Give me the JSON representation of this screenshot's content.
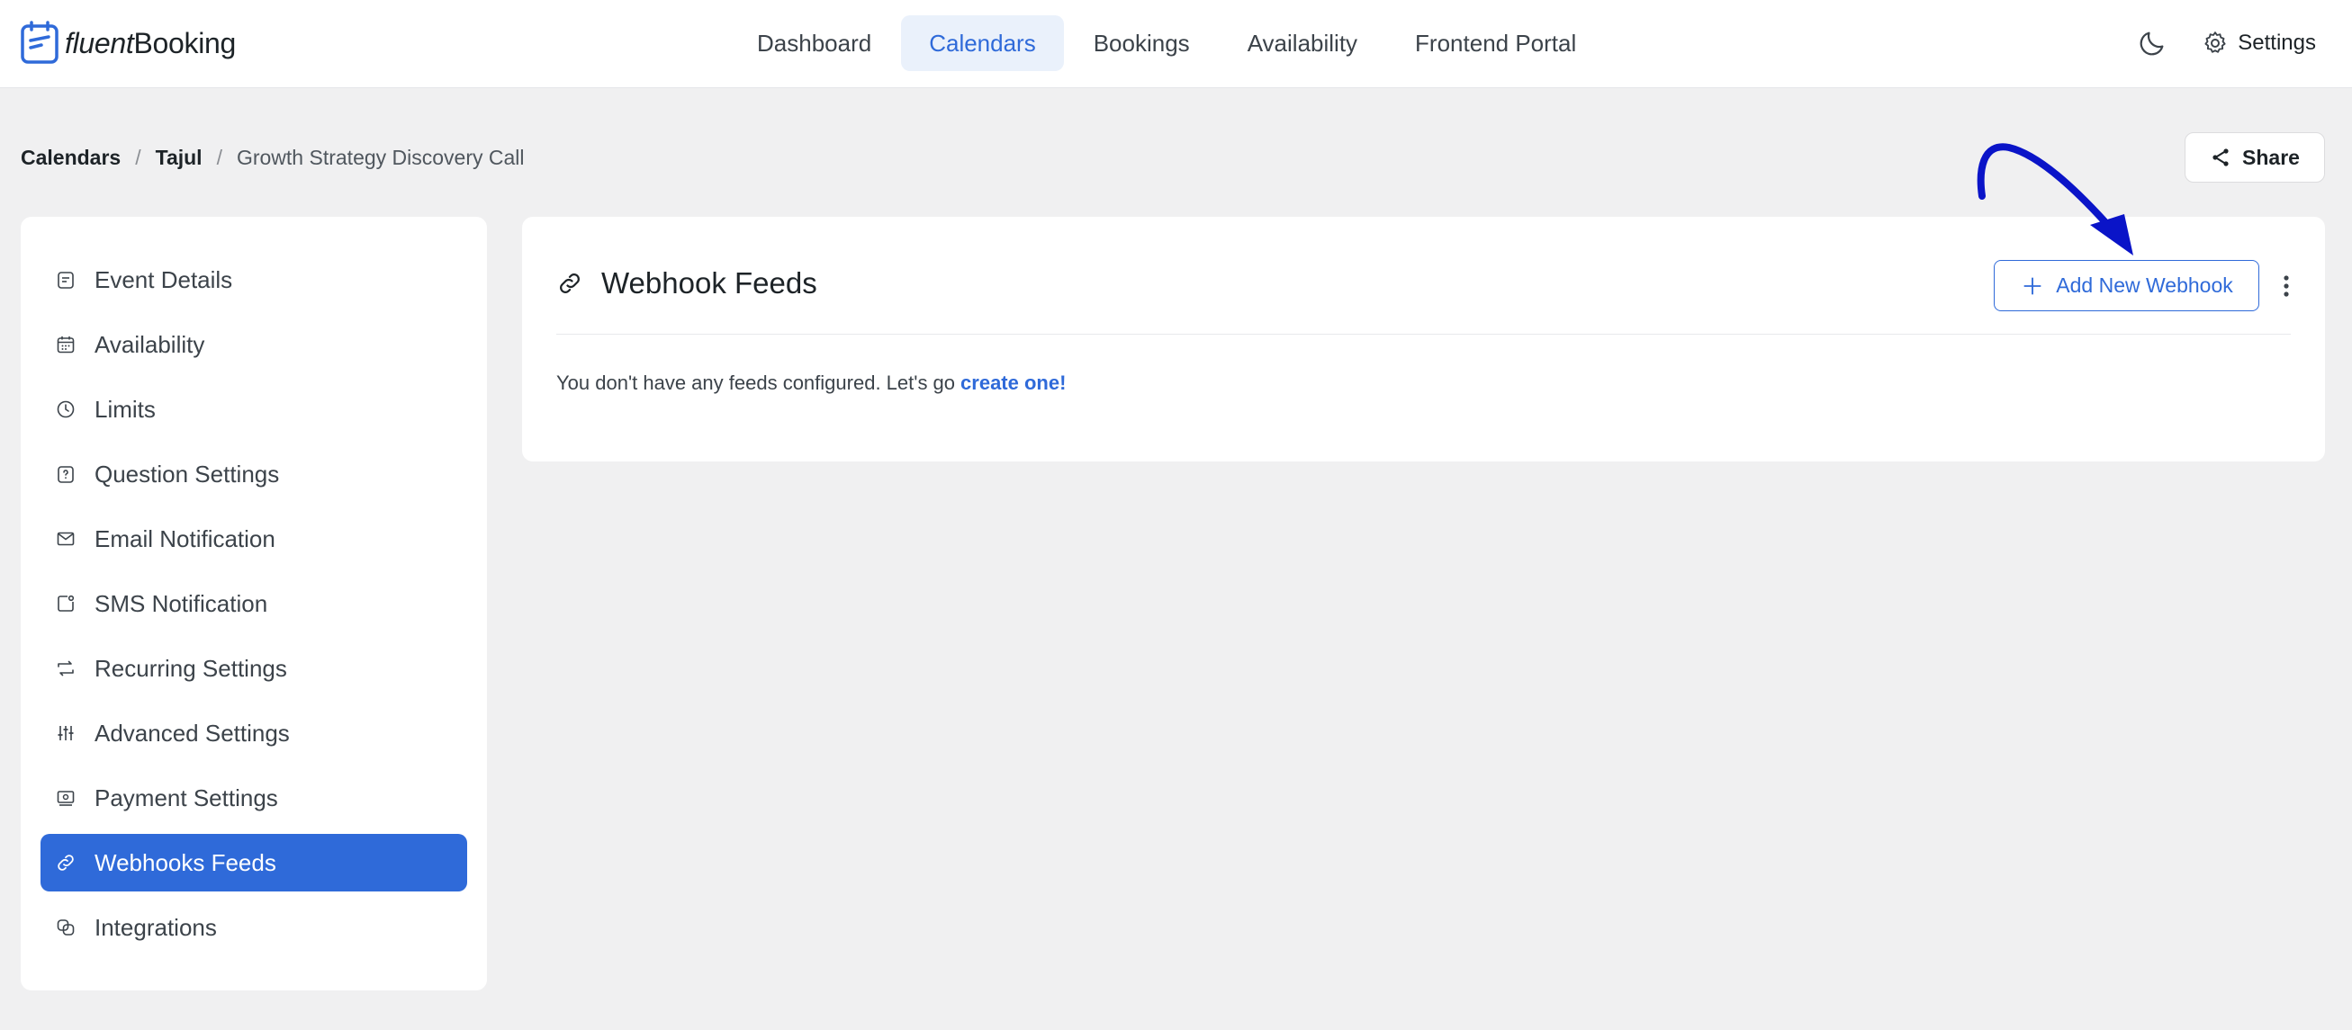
{
  "brand": {
    "light": "fluent",
    "bold": "Booking"
  },
  "nav": [
    {
      "label": "Dashboard",
      "active": false
    },
    {
      "label": "Calendars",
      "active": true
    },
    {
      "label": "Bookings",
      "active": false
    },
    {
      "label": "Availability",
      "active": false
    },
    {
      "label": "Frontend Portal",
      "active": false
    }
  ],
  "topright": {
    "settings_label": "Settings"
  },
  "breadcrumb": {
    "root": "Calendars",
    "host": "Tajul",
    "current": "Growth Strategy Discovery Call",
    "separator": "/"
  },
  "share_label": "Share",
  "sidebar": {
    "items": [
      {
        "label": "Event Details",
        "icon": "event-details-icon"
      },
      {
        "label": "Availability",
        "icon": "calendar-icon"
      },
      {
        "label": "Limits",
        "icon": "clock-icon"
      },
      {
        "label": "Question Settings",
        "icon": "question-icon"
      },
      {
        "label": "Email Notification",
        "icon": "envelope-icon"
      },
      {
        "label": "SMS Notification",
        "icon": "sms-icon"
      },
      {
        "label": "Recurring Settings",
        "icon": "recurring-icon"
      },
      {
        "label": "Advanced Settings",
        "icon": "sliders-icon"
      },
      {
        "label": "Payment Settings",
        "icon": "payment-icon"
      },
      {
        "label": "Webhooks Feeds",
        "icon": "link-icon",
        "active": true
      },
      {
        "label": "Integrations",
        "icon": "integrations-icon"
      }
    ]
  },
  "main": {
    "title": "Webhook Feeds",
    "add_button": "Add New Webhook",
    "empty_text": "You don't have any feeds configured. Let's go",
    "empty_link": "create one!"
  },
  "colors": {
    "accent": "#2f6ad9",
    "annotation": "#0a14c8"
  }
}
